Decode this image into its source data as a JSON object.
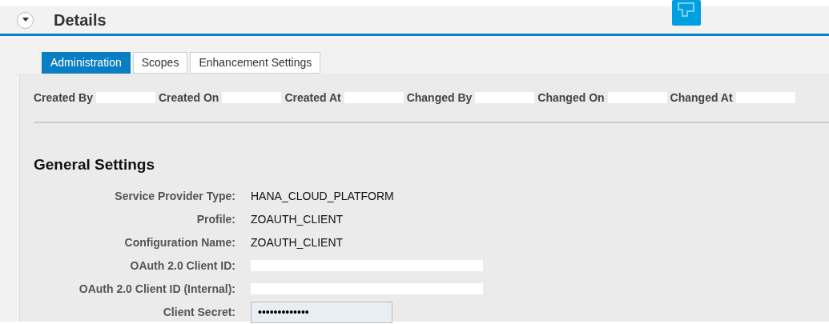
{
  "section": {
    "title": "Details",
    "expanded": true
  },
  "tabs": [
    {
      "label": "Administration",
      "selected": true
    },
    {
      "label": "Scopes",
      "selected": false
    },
    {
      "label": "Enhancement Settings",
      "selected": false
    }
  ],
  "admin_data": [
    {
      "label": "Created By",
      "redacted": true
    },
    {
      "label": "Created On",
      "redacted": true
    },
    {
      "label": "Created At",
      "redacted": true
    },
    {
      "label": "Changed By",
      "redacted": true
    },
    {
      "label": "Changed On",
      "redacted": true
    },
    {
      "label": "Changed At",
      "redacted": true
    }
  ],
  "general_settings": {
    "title": "General Settings",
    "fields": [
      {
        "kind": "text",
        "label": "Service Provider Type:",
        "value": "HANA_CLOUD_PLATFORM"
      },
      {
        "kind": "text",
        "label": "Profile:",
        "value": "ZOAUTH_CLIENT"
      },
      {
        "kind": "text",
        "label": "Configuration Name:",
        "value": "ZOAUTH_CLIENT"
      },
      {
        "kind": "redacted",
        "label": "OAuth 2.0 Client ID:"
      },
      {
        "kind": "redacted",
        "label": "OAuth 2.0 Client ID (Internal):"
      },
      {
        "kind": "password",
        "label": "Client Secret:",
        "value": "•••••••••••••"
      }
    ]
  }
}
